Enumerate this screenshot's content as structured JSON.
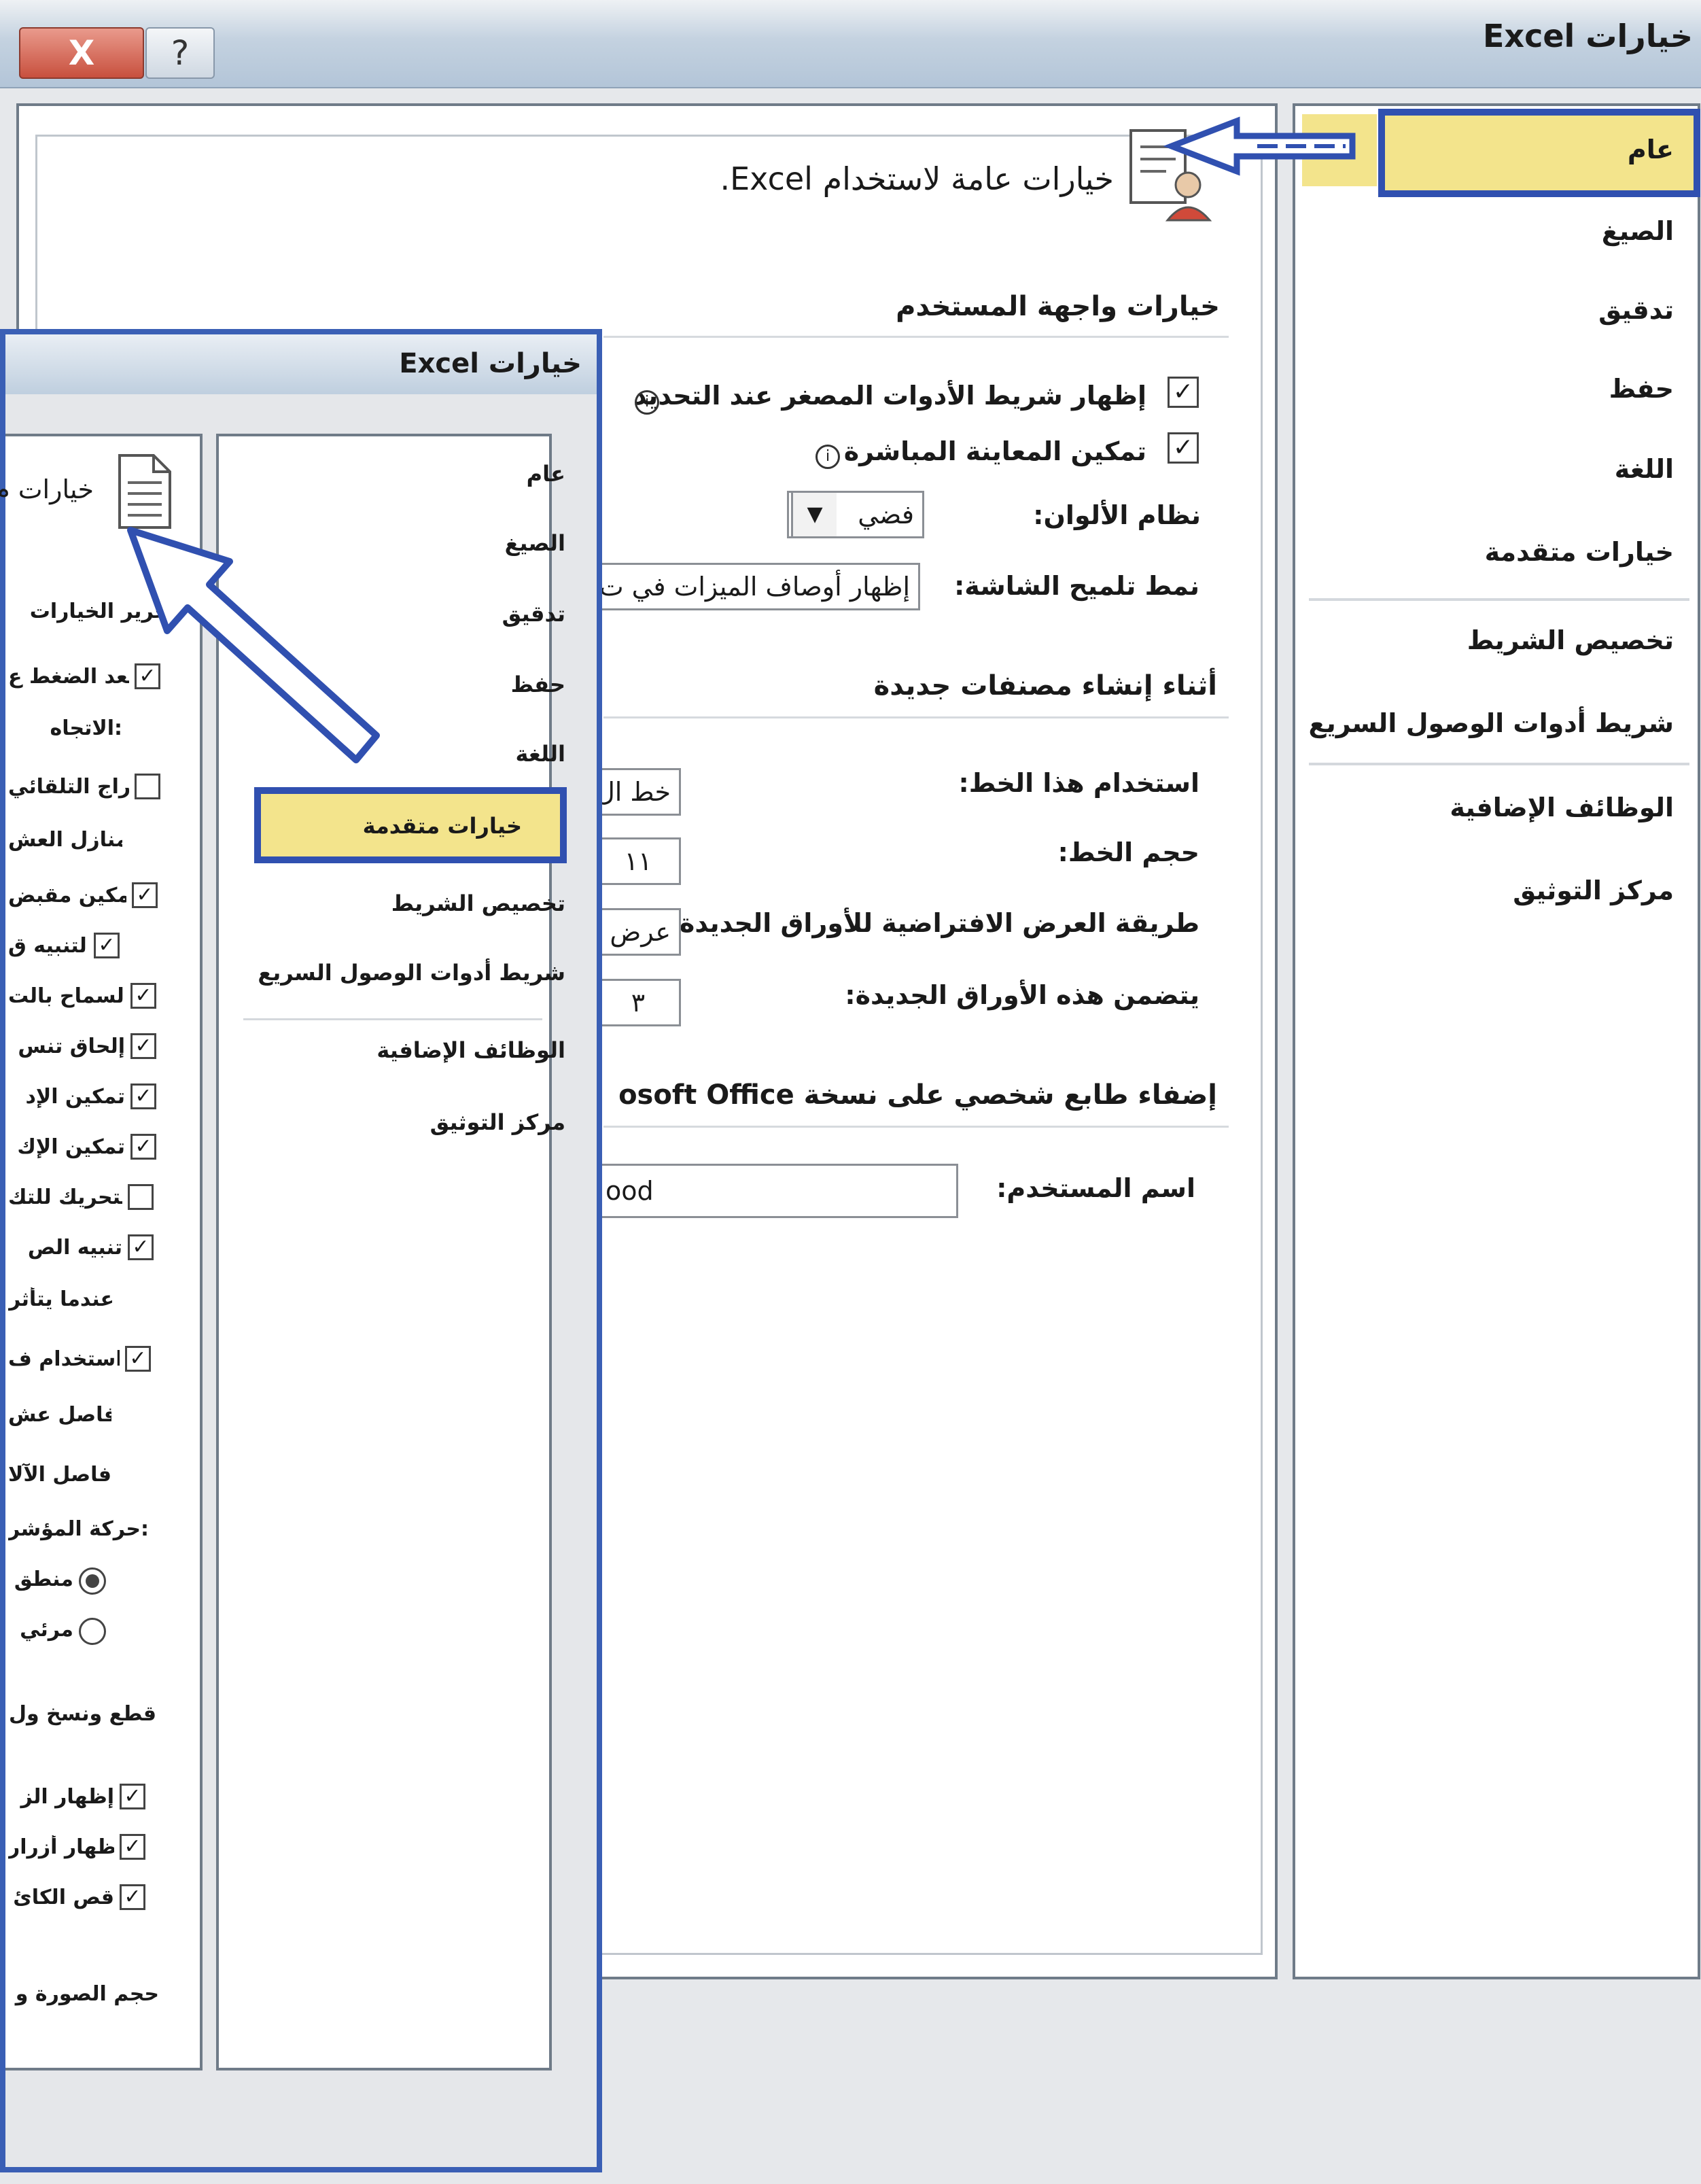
{
  "main_dialog": {
    "title": "خيارات Excel",
    "close_glyph": "X",
    "help_glyph": "?",
    "nav": {
      "items": [
        {
          "label": "عام",
          "selected": true
        },
        {
          "label": "الصيغ"
        },
        {
          "label": "تدقيق"
        },
        {
          "label": "حفظ"
        },
        {
          "label": "اللغة"
        },
        {
          "label": "خيارات متقدمة"
        },
        {
          "label": "تخصيص الشريط"
        },
        {
          "label": "شريط أدوات الوصول السريع"
        },
        {
          "label": "الوظائف الإضافية"
        },
        {
          "label": "مركز التوثيق"
        }
      ]
    },
    "content": {
      "heading": "خيارات عامة لاستخدام Excel.",
      "heading_icon": "general-options-icon",
      "ui_section": {
        "title": "خيارات واجهة المستخدم",
        "show_mini_toolbar": {
          "label": "إظهار شريط الأدوات المصغر عند التحديد",
          "checked": true
        },
        "enable_live_preview": {
          "label": "تمكين المعاينة المباشرة",
          "checked": true
        },
        "color_scheme": {
          "label": "نظام الألوان:",
          "value": "فضي"
        },
        "screentip_style": {
          "label": "نمط تلميح الشاشة:",
          "value": "إظهار أوصاف الميزات في ت"
        }
      },
      "new_workbook_section": {
        "title": "أثناء إنشاء مصنفات جديدة",
        "font": {
          "label": "استخدام هذا الخط:",
          "value": "خط ال"
        },
        "font_size": {
          "label": "حجم الخط:",
          "value": "١١"
        },
        "default_view": {
          "label": "طريقة العرض الافتراضية للأوراق الجديدة:",
          "value": "عرض"
        },
        "sheet_count": {
          "label": "يتضمن هذه الأوراق الجديدة:",
          "value": "٣"
        }
      },
      "personalize_section": {
        "title": "إضفاء طابع شخصي على نسخة Microsoft Office",
        "title_visible": "إضفاء طابع شخصي على نسخة osoft Office",
        "user_name": {
          "label": "اسم المستخدم:",
          "value": "ood"
        }
      }
    }
  },
  "inset_dialog": {
    "title": "خيارات Excel",
    "nav": {
      "items": [
        {
          "label": "عام"
        },
        {
          "label": "الصيغ"
        },
        {
          "label": "تدقيق"
        },
        {
          "label": "حفظ"
        },
        {
          "label": "اللغة"
        },
        {
          "label": "خيارات متقدمة",
          "selected": true
        },
        {
          "label": "تخصيص الشريط"
        },
        {
          "label": "شريط أدوات الوصول السريع"
        },
        {
          "label": "الوظائف الإضافية"
        },
        {
          "label": "مركز التوثيق"
        }
      ]
    },
    "content": {
      "heading": "خيارات م",
      "heading_icon": "document-icon",
      "edit_section_title": "تحرير الخيارات",
      "rows": [
        {
          "label": "بعد الضغط ع",
          "checkbox": true,
          "checked": true
        },
        {
          "label": "الاتجاه:"
        },
        {
          "label": "إدراج التلقائي",
          "checkbox": true,
          "checked": false
        },
        {
          "label": "المنازل العش"
        },
        {
          "label": "تمكين مقبض",
          "checkbox": true,
          "checked": true
        },
        {
          "label": "التنبيه ق",
          "checkbox": true,
          "checked": true
        },
        {
          "label": "السماح بالت",
          "checkbox": true,
          "checked": true
        },
        {
          "label": "إلحاق تنس",
          "checkbox": true,
          "checked": true
        },
        {
          "label": "تمكين الإد",
          "checkbox": true,
          "checked": true
        },
        {
          "label": "تمكين الإك",
          "checkbox": true,
          "checked": true
        },
        {
          "label": "التحريك للتك",
          "checkbox": true,
          "checked": false
        },
        {
          "label": "تنبيه الص",
          "checkbox": true,
          "checked": true
        },
        {
          "label": "عندما يتأثر"
        },
        {
          "label": "استخدام ف",
          "checkbox": true,
          "checked": true
        },
        {
          "label": "فاصل عش"
        },
        {
          "label": "فاصل الآلا"
        },
        {
          "label": "حركة المؤشر:"
        },
        {
          "label": "منطق",
          "radio": true,
          "selected": true
        },
        {
          "label": "مرئي",
          "radio": true,
          "selected": false
        }
      ],
      "cut_copy_title": "قطع ونسخ ول",
      "cut_copy_rows": [
        {
          "label": "إظهار الز",
          "checked": true
        },
        {
          "label": "إظهار أزرار",
          "checked": true
        },
        {
          "label": "قص الكائ",
          "checked": true
        }
      ],
      "image_size_title": "حجم الصورة و"
    }
  },
  "annotations": {
    "arrow_color": "#3050b0",
    "highlight_color": "#f3e48c"
  }
}
